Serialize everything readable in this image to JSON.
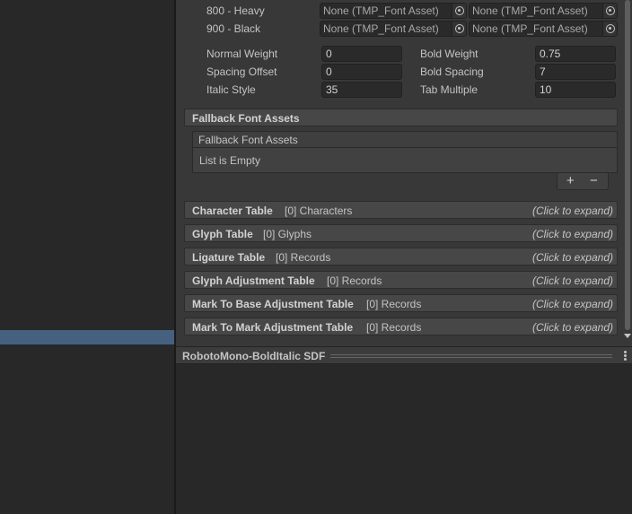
{
  "font_weights": [
    {
      "label": "800 - Heavy",
      "regular": "None (TMP_Font Asset)",
      "italic": "None (TMP_Font Asset)"
    },
    {
      "label": "900 - Black",
      "regular": "None (TMP_Font Asset)",
      "italic": "None (TMP_Font Asset)"
    }
  ],
  "settings": {
    "normal_weight_label": "Normal Weight",
    "normal_weight": "0",
    "bold_weight_label": "Bold Weight",
    "bold_weight": "0.75",
    "spacing_offset_label": "Spacing Offset",
    "spacing_offset": "0",
    "bold_spacing_label": "Bold Spacing",
    "bold_spacing": "7",
    "italic_style_label": "Italic Style",
    "italic_style": "35",
    "tab_multiple_label": "Tab Multiple",
    "tab_multiple": "10"
  },
  "fallback": {
    "section_title": "Fallback Font Assets",
    "list_title": "Fallback Font Assets",
    "empty_text": "List is Empty",
    "add_label": "+",
    "remove_label": "−"
  },
  "tables": [
    {
      "title": "Character Table",
      "count": "[0] Characters",
      "expand": "(Click to expand)"
    },
    {
      "title": "Glyph Table",
      "count": "[0] Glyphs",
      "expand": "(Click to expand)"
    },
    {
      "title": "Ligature Table",
      "count": "[0] Records",
      "expand": "(Click to expand)"
    },
    {
      "title": "Glyph Adjustment Table",
      "count": "[0] Records",
      "expand": "(Click to expand)"
    },
    {
      "title": "Mark To Base Adjustment Table",
      "count": "[0] Records",
      "expand": "(Click to expand)"
    },
    {
      "title": "Mark To Mark Adjustment Table",
      "count": "[0] Records",
      "expand": "(Click to expand)"
    }
  ],
  "preview": {
    "title": "RobotoMono-BoldItalic SDF"
  },
  "icons": {
    "object_picker": "object-picker-icon",
    "menu": "kebab-menu-icon",
    "scroll_down": "scroll-down-arrow-icon"
  },
  "colors": {
    "selection": "#46607f",
    "panel": "#383838",
    "background": "#282828"
  }
}
